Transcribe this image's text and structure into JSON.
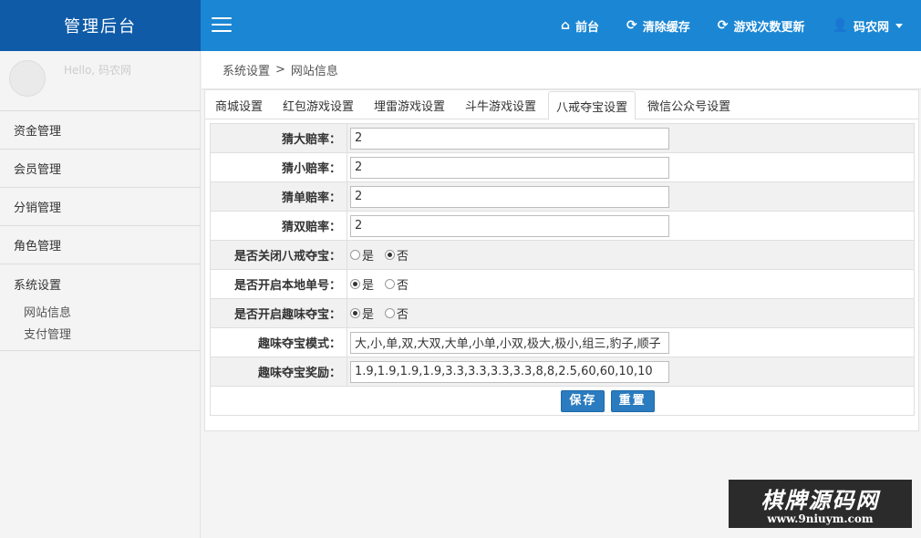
{
  "brand": "管理后台",
  "nav": [
    {
      "icon": "home-icon",
      "glyph": "⌂",
      "label": "前台"
    },
    {
      "icon": "refresh-icon",
      "glyph": "⟳",
      "label": "清除缓存"
    },
    {
      "icon": "refresh-icon",
      "glyph": "⟳",
      "label": "游戏次数更新"
    }
  ],
  "user": {
    "icon": "user-icon",
    "name": "码农网",
    "hello": "Hello, 码农网"
  },
  "sidebar": {
    "items": [
      {
        "label": "资金管理"
      },
      {
        "label": "会员管理"
      },
      {
        "label": "分销管理"
      },
      {
        "label": "角色管理"
      }
    ],
    "group": {
      "label": "系统设置",
      "children": [
        {
          "label": "网站信息"
        },
        {
          "label": "支付管理"
        }
      ]
    }
  },
  "breadcrumb": {
    "parent": "系统设置",
    "separator": ">",
    "current": "网站信息"
  },
  "tabs": [
    {
      "label": "商城设置",
      "active": false
    },
    {
      "label": "红包游戏设置",
      "active": false
    },
    {
      "label": "埋雷游戏设置",
      "active": false
    },
    {
      "label": "斗牛游戏设置",
      "active": false
    },
    {
      "label": "八戒夺宝设置",
      "active": true
    },
    {
      "label": "微信公众号设置",
      "active": false
    }
  ],
  "form": {
    "guess_big": {
      "label": "猜大赔率：",
      "value": "2"
    },
    "guess_small": {
      "label": "猜小赔率：",
      "value": "2"
    },
    "guess_odd": {
      "label": "猜单赔率：",
      "value": "2"
    },
    "guess_even": {
      "label": "猜双赔率：",
      "value": "2"
    },
    "close_bajie": {
      "label": "是否关闭八戒夺宝：",
      "yes": "是",
      "no": "否",
      "selected": "no"
    },
    "local_single": {
      "label": "是否开启本地单号：",
      "yes": "是",
      "no": "否",
      "selected": "yes"
    },
    "fun_treasure": {
      "label": "是否开启趣味夺宝：",
      "yes": "是",
      "no": "否",
      "selected": "yes"
    },
    "fun_mode": {
      "label": "趣味夺宝模式：",
      "value": "大,小,单,双,大双,大单,小单,小双,极大,极小,组三,豹子,顺子"
    },
    "fun_reward": {
      "label": "趣味夺宝奖励：",
      "value": "1.9,1.9,1.9,1.9,3.3,3.3,3.3,3.3,8,8,2.5,60,60,10,10"
    },
    "save_label": "保存",
    "reset_label": "重置"
  },
  "watermark": {
    "title": "棋牌源码网",
    "url": "www.9niuym.com"
  }
}
